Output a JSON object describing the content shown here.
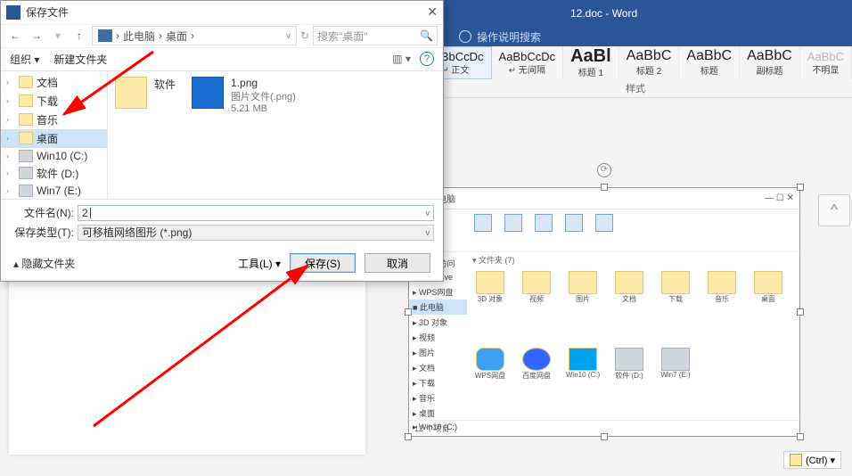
{
  "word": {
    "title": "12.doc  -  Word",
    "tell_me": "操作说明搜索",
    "styles": [
      {
        "sample": "AaBbCcDc",
        "name": "↵ 正文",
        "cls": "",
        "active": true
      },
      {
        "sample": "AaBbCcDc",
        "name": "↵ 无间隔",
        "cls": "",
        "active": false
      },
      {
        "sample": "AaBl",
        "name": "标题 1",
        "cls": "big",
        "active": false
      },
      {
        "sample": "AaBbC",
        "name": "标题 2",
        "cls": "mid",
        "active": false
      },
      {
        "sample": "AaBbC",
        "name": "标题",
        "cls": "mid",
        "active": false
      },
      {
        "sample": "AaBbC",
        "name": "副标题",
        "cls": "mid",
        "active": false
      },
      {
        "sample": "AaBbC",
        "name": "不明显",
        "cls": "light",
        "active": false
      }
    ],
    "styles_group": "样式",
    "paste_options": "(Ctrl) ▾"
  },
  "dialog": {
    "title": "保存文件",
    "nav": {
      "back": "←",
      "fwd": "→",
      "up": "↑"
    },
    "breadcrumb": [
      "此电脑",
      "桌面"
    ],
    "search_placeholder": "搜索\"桌面\"",
    "cmdbar": {
      "organize": "组织 ▾",
      "newfolder": "新建文件夹",
      "help": "?"
    },
    "tree": [
      {
        "label": "文档",
        "icon": "folder",
        "exp": "›",
        "sel": false
      },
      {
        "label": "下载",
        "icon": "folder",
        "exp": "›",
        "sel": false
      },
      {
        "label": "音乐",
        "icon": "folder",
        "exp": "›",
        "sel": false
      },
      {
        "label": "桌面",
        "icon": "folder",
        "exp": "›",
        "sel": true
      },
      {
        "label": "Win10 (C:)",
        "icon": "drive",
        "exp": "›",
        "sel": false
      },
      {
        "label": "软件 (D:)",
        "icon": "drive",
        "exp": "›",
        "sel": false
      },
      {
        "label": "Win7 (E:)",
        "icon": "drive",
        "exp": "›",
        "sel": false
      }
    ],
    "files": [
      {
        "name": "软件",
        "type": "folder",
        "sub1": "",
        "sub2": ""
      },
      {
        "name": "1.png",
        "type": "img",
        "sub1": "图片文件(.png)",
        "sub2": "5.21 MB"
      }
    ],
    "filename_label": "文件名(N):",
    "filename_value": "2",
    "filetype_label": "保存类型(T):",
    "filetype_value": "可移植网络图形 (*.png)",
    "hide_folders": "▴ 隐藏文件夹",
    "tools": "工具(L) ▾",
    "save": "保存(S)",
    "cancel": "取消"
  },
  "embedded": {
    "title_left": "▮ ▸ 此电脑",
    "win_btns": "—  ☐  ✕",
    "tree": [
      "☆ 快速访问",
      "▸ OneDrive",
      "▸ WPS网盘",
      "■ 此电脑",
      "  ▸ 3D 对象",
      "  ▸ 视频",
      "  ▸ 图片",
      "  ▸ 文档",
      "  ▸ 下载",
      "  ▸ 音乐",
      "  ▸ 桌面",
      "  ▸ Win10 (C:)"
    ],
    "sel_index": 3,
    "group1": "▾ 文件夹 (7)",
    "items1": [
      "3D 对象",
      "视频",
      "图片",
      "文档",
      "下载",
      "音乐",
      "桌面"
    ],
    "items2": [
      {
        "name": "WPS网盘",
        "cls": "cloud"
      },
      {
        "name": "百度网盘",
        "cls": "bd"
      },
      {
        "name": "Win10 (C:)",
        "cls": "win"
      },
      {
        "name": "软件 (D:)",
        "cls": "drive"
      },
      {
        "name": "Win7 (E:)",
        "cls": "drive"
      }
    ],
    "status": "12 个项目"
  }
}
